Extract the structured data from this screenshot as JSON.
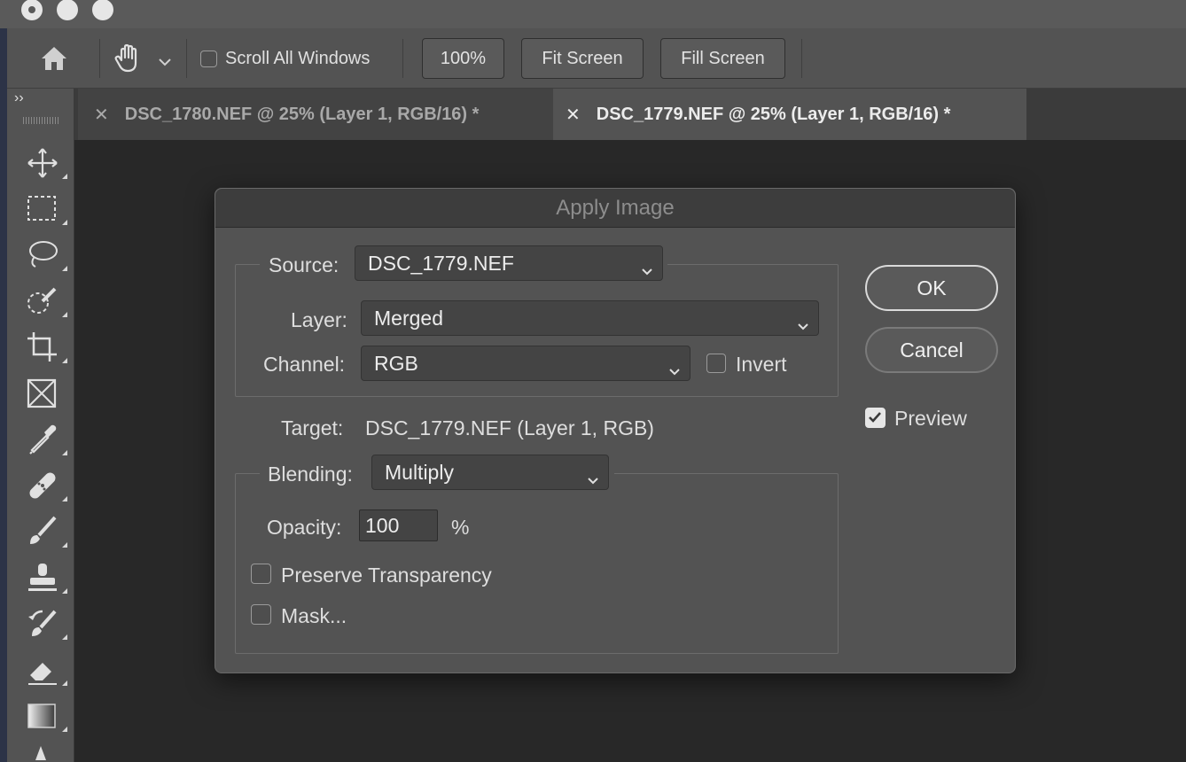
{
  "options_bar": {
    "scroll_all_windows_label": "Scroll All Windows",
    "scroll_all_windows_checked": false,
    "zoom_100_label": "100%",
    "fit_screen_label": "Fit Screen",
    "fill_screen_label": "Fill Screen"
  },
  "toolbox": {
    "collapse_glyph": "››",
    "tools": [
      "move-tool-icon",
      "marquee-tool-icon",
      "lasso-tool-icon",
      "quick-selection-tool-icon",
      "crop-tool-icon",
      "frame-tool-icon",
      "eyedropper-tool-icon",
      "healing-brush-tool-icon",
      "brush-tool-icon",
      "clone-stamp-tool-icon",
      "history-brush-tool-icon",
      "eraser-tool-icon",
      "gradient-tool-icon",
      "blur-tool-icon"
    ]
  },
  "tabs": [
    {
      "close": "✕",
      "label": "DSC_1780.NEF @ 25% (Layer 1, RGB/16) *",
      "active": false
    },
    {
      "close": "✕",
      "label": "DSC_1779.NEF @ 25% (Layer 1, RGB/16) *",
      "active": true
    }
  ],
  "dialog": {
    "title": "Apply Image",
    "source_label": "Source:",
    "source_value": "DSC_1779.NEF",
    "layer_label": "Layer:",
    "layer_value": "Merged",
    "channel_label": "Channel:",
    "channel_value": "RGB",
    "invert_label": "Invert",
    "invert_checked": false,
    "target_label": "Target:",
    "target_value": "DSC_1779.NEF (Layer 1, RGB)",
    "blending_label": "Blending:",
    "blending_value": "Multiply",
    "opacity_label": "Opacity:",
    "opacity_value": "100",
    "opacity_unit": "%",
    "preserve_transparency_label": "Preserve Transparency",
    "preserve_transparency_checked": false,
    "mask_label": "Mask...",
    "mask_checked": false,
    "ok_label": "OK",
    "cancel_label": "Cancel",
    "preview_label": "Preview",
    "preview_checked": true
  },
  "colors": {
    "chrome": "#535353",
    "canvas": "#282828",
    "dialog_title_bar": "#3d3d3d",
    "field": "#444444"
  }
}
